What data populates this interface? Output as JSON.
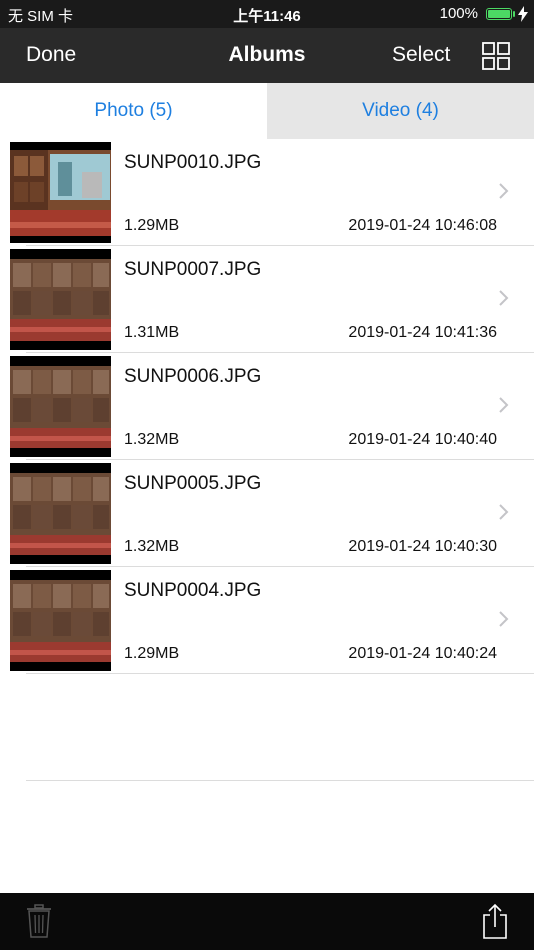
{
  "status_bar": {
    "carrier": "无 SIM 卡",
    "time": "上午11:46",
    "battery_percent": "100%"
  },
  "nav": {
    "done_label": "Done",
    "title": "Albums",
    "select_label": "Select",
    "grid_icon": "grid-view-icon"
  },
  "tabs": {
    "photo_label": "Photo (5)",
    "video_label": "Video (4)"
  },
  "files": [
    {
      "name": "SUNP0010.JPG",
      "size": "1.29MB",
      "date": "2019-01-24 10:46:08"
    },
    {
      "name": "SUNP0007.JPG",
      "size": "1.31MB",
      "date": "2019-01-24 10:41:36"
    },
    {
      "name": "SUNP0006.JPG",
      "size": "1.32MB",
      "date": "2019-01-24 10:40:40"
    },
    {
      "name": "SUNP0005.JPG",
      "size": "1.32MB",
      "date": "2019-01-24 10:40:30"
    },
    {
      "name": "SUNP0004.JPG",
      "size": "1.29MB",
      "date": "2019-01-24 10:40:24"
    }
  ],
  "toolbar": {
    "delete_icon": "trash-icon",
    "share_icon": "share-icon"
  },
  "colors": {
    "accent": "#1e7fe0",
    "nav_bg": "#2a2a2a",
    "toolbar_bg": "#0a0a0a",
    "battery": "#4cd964"
  }
}
